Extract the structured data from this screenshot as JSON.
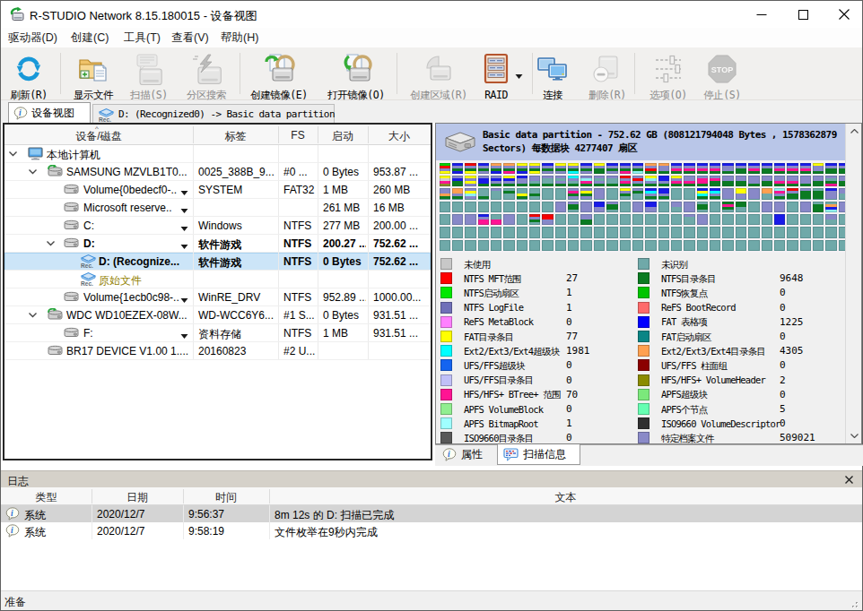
{
  "window": {
    "title": "R-STUDIO Network 8.15.180015 - 设备视图",
    "controls": [
      "minimize",
      "maximize",
      "close"
    ]
  },
  "menu": [
    "驱动器(D)",
    "创建(C)",
    "工具(T)",
    "查看(V)",
    "帮助(H)"
  ],
  "toolbar": [
    {
      "id": "refresh",
      "label": "刷新(R)",
      "icon": "refresh-icon",
      "enabled": true
    },
    {
      "id": "show-files",
      "label": "显示文件",
      "icon": "show-files-icon",
      "enabled": true
    },
    {
      "id": "scan",
      "label": "扫描(S)",
      "icon": "scan-icon",
      "enabled": false
    },
    {
      "id": "partition-search",
      "label": "分区搜索",
      "icon": "partition-search-icon",
      "enabled": false
    },
    {
      "id": "create-image",
      "label": "创建镜像(E)",
      "icon": "create-image-icon",
      "enabled": true
    },
    {
      "id": "open-image",
      "label": "打开镜像(O)",
      "icon": "open-image-icon",
      "enabled": true
    },
    {
      "id": "create-region",
      "label": "创建区域(R)",
      "icon": "create-region-icon",
      "enabled": false
    },
    {
      "id": "raid",
      "label": "RAID",
      "icon": "raid-icon",
      "enabled": true,
      "dropdown": true
    },
    {
      "id": "connect",
      "label": "连接",
      "icon": "connect-icon",
      "enabled": true
    },
    {
      "id": "delete",
      "label": "删除(R)",
      "icon": "delete-icon",
      "enabled": false
    },
    {
      "id": "options",
      "label": "选项(O)",
      "icon": "options-icon",
      "enabled": false
    },
    {
      "id": "stop",
      "label": "停止(S)",
      "icon": "stop-icon",
      "enabled": false
    }
  ],
  "tabs": [
    {
      "label": "设备视图",
      "icon": "info-balloon-icon",
      "active": true
    },
    {
      "label": "D: (Recognized0) -> Basic data partition",
      "icon": "rec-icon",
      "active": false
    }
  ],
  "device_table": {
    "columns": [
      "设备/磁盘",
      "标签",
      "FS",
      "启动",
      "大小"
    ],
    "rows": [
      {
        "name": "本地计算机",
        "label": "",
        "fs": "",
        "start": "",
        "size": "",
        "level": 0,
        "icon": "computer-icon",
        "chevron": true
      },
      {
        "name": "SAMSUNG MZVLB1T0...",
        "label": "0025_388B_9...",
        "fs": "#0 ...",
        "start": "0 Bytes",
        "size": "953.87 ...",
        "level": 1,
        "icon": "disk-scanned-icon",
        "chevron": true
      },
      {
        "name": "Volume{0bedecf0-..",
        "label": "SYSTEM",
        "fs": "FAT32",
        "start": "1 MB",
        "size": "260 MB",
        "level": 2,
        "icon": "disk-icon",
        "droparrow": true
      },
      {
        "name": "Microsoft reserve..",
        "label": "",
        "fs": "",
        "start": "261 MB",
        "size": "16 MB",
        "level": 2,
        "icon": "disk-icon",
        "droparrow": true
      },
      {
        "name": "C:",
        "label": "Windows",
        "fs": "NTFS",
        "start": "277 MB",
        "size": "200.00 ...",
        "level": 2,
        "icon": "disk-icon",
        "droparrow": true
      },
      {
        "name": "D:",
        "label": "软件游戏",
        "fs": "NTFS",
        "start": "200.27 ...",
        "size": "752.62 ...",
        "level": 2,
        "icon": "disk-icon",
        "droparrow": true,
        "bold": true,
        "chevron": true
      },
      {
        "name": "D: (Recognize...",
        "label": "软件游戏",
        "fs": "NTFS",
        "start": "0 Bytes",
        "size": "752.62 ...",
        "level": 3,
        "icon": "rec-icon",
        "bold": true,
        "selected": true
      },
      {
        "name": "原始文件",
        "label": "",
        "fs": "",
        "start": "",
        "size": "",
        "level": 3,
        "icon": "rec-icon",
        "olive": true
      },
      {
        "name": "Volume{1ecb0c98-..",
        "label": "WinRE_DRV",
        "fs": "NTFS",
        "start": "952.89 ...",
        "size": "1000.00...",
        "level": 2,
        "icon": "disk-icon",
        "droparrow": true
      },
      {
        "name": "WDC WD10EZEX-08W...",
        "label": "WD-WCC6Y6...",
        "fs": "#1 S...",
        "start": "0 Bytes",
        "size": "931.51 ...",
        "level": 1,
        "icon": "disk-scanned-icon",
        "chevron": true
      },
      {
        "name": "F:",
        "label": "资料存储",
        "fs": "NTFS",
        "start": "1 MB",
        "size": "931.51 ...",
        "level": 2,
        "icon": "disk-icon",
        "droparrow": true
      },
      {
        "name": "BR17 DEVICE V1.00 1....",
        "label": "20160823",
        "fs": "#2 U...",
        "start": "",
        "size": "",
        "level": 1,
        "icon": "disk-icon"
      }
    ]
  },
  "scan_panel": {
    "header_line1": "Basic data partition - 752.62 GB (808121794048 Bytes , 1578362879",
    "header_line2": "Sectors) 每数据块 4277407 扇区",
    "header_icon": "disk-large-icon",
    "scrollbar": {
      "up": "scroll-up-arrow",
      "down": "scroll-down-arrow"
    }
  },
  "blocks": {
    "cols": 32,
    "rows": 7,
    "palette": {
      "t": "#6FA9A9",
      "p": "#8888C8",
      "d": "#0B7B22",
      "b": "#1A1AE8",
      "y": "#FFFF00",
      "r": "#F40000",
      "k": "#FF1493",
      "o": "#FFA050",
      "c": "#00FFFF",
      "g": "#00D000",
      "m": "#FF80FF",
      "l": "#BCBCEC",
      "a": "#90F0F0",
      "w": "#D0D0D0",
      "v": "#8B8B2A",
      "e": "#90EE90"
    },
    "cells": [
      [
        "grpy",
        "bpdb",
        "rpdy",
        "bpdp",
        "opdb",
        "opdk",
        "ypdb",
        "ypdy",
        "bpdp",
        "ypdp",
        "ypdc",
        "bpdp",
        "ypdd",
        "bpdp",
        "bpdk",
        "bpda",
        "oprd",
        "oppd",
        "bpkd",
        "bpkd",
        "bpkd",
        "bpkd",
        "bppd",
        "bpdd",
        "bpkd",
        "bpdd",
        "bpkd",
        "bpkd",
        "bpkd",
        "yppd",
        "bpdd",
        "bpdd"
      ],
      [
        "ywkv",
        "pbdd",
        "ypyp",
        "pbbd",
        "pbpd",
        "ybpd",
        "bppd",
        "pptd",
        "pttd",
        "ptpd",
        "cptd",
        "pakd",
        "ptpd",
        "pttd",
        "rpkd",
        "prpd",
        "yapd",
        "bbpd",
        "ypkd",
        "ppkd",
        "pkkd",
        "pkdd",
        "ppdd",
        "ppdd",
        "pppd",
        "ppdd",
        "ppkd",
        "ppkd",
        "pppd",
        "ppdd",
        "ptdk",
        "ppdd"
      ],
      [
        "ppod",
        "oopd",
        "pyap",
        "tttd",
        "pttt",
        "tdtt",
        "ttyd",
        "ttdt",
        "",
        "",
        "pkdp",
        "pydp",
        "pppp",
        "",
        "ypd",
        "pd",
        "bcpd",
        "bbpd",
        "",
        "",
        "bycd",
        "bcpd",
        "pppp",
        "yypp",
        "pppp",
        "oo",
        "akpd",
        "rpdd",
        "pddd",
        "tddd",
        "bppp",
        "pp"
      ],
      [
        "",
        "",
        "",
        "",
        "",
        "",
        "",
        "",
        "",
        "pppp",
        "pdd",
        "pppp",
        "bbpp",
        "pdd",
        "",
        "pppp",
        "bbpp",
        "",
        "pp",
        "pppp",
        "tdd",
        "",
        "dkd",
        "dd",
        "",
        "pppp",
        "pppp",
        "",
        "pppp",
        "tddd",
        "toba",
        "pppp"
      ],
      [
        "",
        "pppp",
        "pppp",
        "bpkk",
        "ttkk",
        "pppp",
        "",
        "rpd",
        "rrpp",
        "",
        "",
        "ppdd",
        "",
        "",
        "",
        "",
        "",
        "",
        "",
        "p",
        "pppp",
        "",
        "",
        "",
        "",
        "",
        "bbbb",
        "",
        "",
        "",
        "pp",
        ""
      ],
      [
        "",
        "",
        "",
        "",
        "",
        "",
        "",
        "",
        "",
        "",
        "",
        "",
        "",
        "",
        "",
        "",
        "",
        "",
        "",
        "",
        "",
        "",
        "",
        "",
        "",
        "",
        "",
        "",
        "",
        "",
        "",
        ""
      ],
      [
        "",
        "",
        "",
        "",
        "",
        "",
        "",
        "",
        "",
        "",
        "",
        "",
        "",
        "",
        "",
        "",
        "",
        "",
        "",
        "",
        "",
        "",
        "",
        "",
        "",
        "",
        "",
        "",
        "",
        "",
        "",
        ""
      ]
    ]
  },
  "legend": {
    "left": [
      {
        "label": "未使用",
        "count": "",
        "color": "#C8C8C8"
      },
      {
        "label": "NTFS MFT范围",
        "count": "27",
        "color": "#FF0000"
      },
      {
        "label": "NTFS启动扇区",
        "count": "1",
        "color": "#00E800"
      },
      {
        "label": "NTFS LogFile",
        "count": "1",
        "color": "#7070B8"
      },
      {
        "label": "ReFS MetaBlock",
        "count": "0",
        "color": "#FF80FF"
      },
      {
        "label": "FAT目录条目",
        "count": "77",
        "color": "#FFFF00"
      },
      {
        "label": "Ext2/Ext3/Ext4超级块",
        "count": "1981",
        "color": "#00FFFF"
      },
      {
        "label": "UFS/FFS超级块",
        "count": "0",
        "color": "#1464F0"
      },
      {
        "label": "UFS/FFS目录条目",
        "count": "0",
        "color": "#C0C0F8"
      },
      {
        "label": "HFS/HFS+ BTree+ 范围",
        "count": "70",
        "color": "#FF1493"
      },
      {
        "label": "APFS VolumeBlock",
        "count": "0",
        "color": "#90EE90"
      },
      {
        "label": "APFS BitmapRoot",
        "count": "1",
        "color": "#A0FFFF"
      },
      {
        "label": "ISO9660目录条目",
        "count": "0",
        "color": "#585858"
      }
    ],
    "right": [
      {
        "label": "未识别",
        "count": "",
        "color": "#6FA9A9"
      },
      {
        "label": "NTFS目录条目",
        "count": "9648",
        "color": "#0B7B22"
      },
      {
        "label": "NTFS恢复点",
        "count": "0",
        "color": "#00C400"
      },
      {
        "label": "ReFS BootRecord",
        "count": "0",
        "color": "#FF6A6A"
      },
      {
        "label": "FAT 表格项",
        "count": "1225",
        "color": "#0000FF"
      },
      {
        "label": "FAT启动扇区",
        "count": "0",
        "color": "#0A8585"
      },
      {
        "label": "Ext2/Ext3/Ext4目录条目",
        "count": "4305",
        "color": "#FFA050"
      },
      {
        "label": "UFS/FFS 柱面组",
        "count": "0",
        "color": "#8B0000"
      },
      {
        "label": "HFS/HFS+ VolumeHeader",
        "count": "2",
        "color": "#8B8B00"
      },
      {
        "label": "APFS超级块",
        "count": "0",
        "color": "#7BE87B"
      },
      {
        "label": "APFS个节点",
        "count": "5",
        "color": "#66FFB2"
      },
      {
        "label": "ISO9660 VolumeDescriptor",
        "count": "0",
        "color": "#303030"
      },
      {
        "label": "特定档案文件",
        "count": "509021",
        "color": "#8A8AC8"
      }
    ]
  },
  "bottom_tabs": [
    {
      "label": "属性",
      "icon": "info-balloon-icon",
      "active": false
    },
    {
      "label": "扫描信息",
      "icon": "scan-info-icon",
      "active": true
    }
  ],
  "log": {
    "title": "日志",
    "columns": [
      "类型",
      "日期",
      "时间",
      "文本"
    ],
    "rows": [
      {
        "type": "系统",
        "date": "2020/12/7",
        "time": "9:56:37",
        "text": "8m 12s 的 D: 扫描已完成",
        "icon": "info-balloon-icon",
        "selected": true
      },
      {
        "type": "系统",
        "date": "2020/12/7",
        "time": "9:58:19",
        "text": "文件枚举在9秒内完成",
        "icon": "info-balloon-icon",
        "selected": false
      }
    ]
  },
  "status_bar": {
    "text": "准备"
  }
}
